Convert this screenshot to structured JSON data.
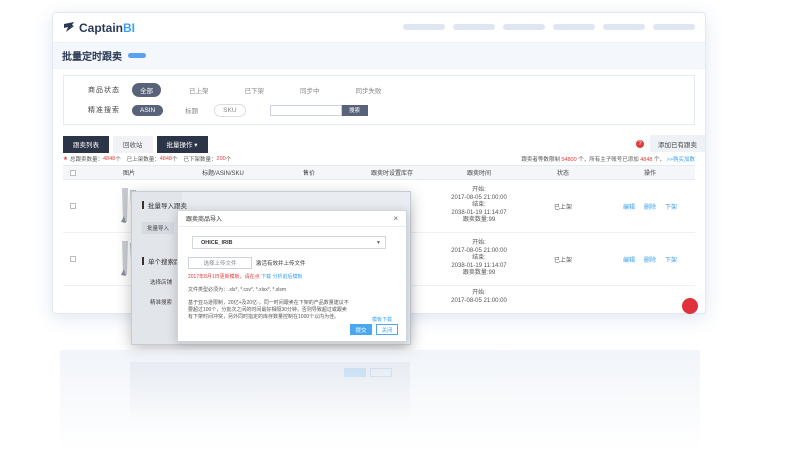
{
  "app": {
    "logo_text": "Captain",
    "logo_accent": "BI",
    "page_title": "批量定时跟卖"
  },
  "filters": {
    "status_label": "商品状态",
    "status_options": [
      "全部",
      "已上架",
      "已下架",
      "同步中",
      "同步失败"
    ],
    "search_label": "精准搜索",
    "search_options": [
      "ASIN",
      "标题",
      "SKU"
    ],
    "search_button": "搜索"
  },
  "toolbar": {
    "tab_follow": "跟卖列表",
    "tab_recycle": "回收站",
    "batch_button": "批量操作 ▾",
    "add_existing": "添加已有跟卖"
  },
  "stats": {
    "total_label": "总跟卖数量：",
    "total_value": "4848",
    "total_unit": "个",
    "on_label": "已上架数量：",
    "on_value": "4848",
    "on_unit": "个",
    "off_label": "已下架数量：",
    "off_value": "200",
    "off_unit": "个",
    "right_text_a": "跟卖者等数限制",
    "right_value_a": "54800",
    "right_text_b": "个，所有主子账号已添加",
    "right_value_b": "4848",
    "right_text_c": "个，",
    "right_link": ">>购买加数"
  },
  "table": {
    "headers": [
      "图片",
      "标题/ASIN/SKU",
      "售价",
      "跟卖时设置库存",
      "跟卖时间",
      "状态",
      "操作"
    ],
    "rows": [
      {
        "time_lines": [
          "开始:",
          "2017-08-05 21:00:00",
          "结束:",
          "2038-01-19 11:14:07",
          "跟卖数量:99"
        ],
        "status": "已上架",
        "ops": [
          "编辑",
          "删除",
          "下架"
        ]
      },
      {
        "time_lines": [
          "开始:",
          "2017-08-05 21:00:00",
          "结束:",
          "2038-01-19 11:14:07",
          "跟卖数量:99"
        ],
        "status": "已上架",
        "ops": [
          "编辑",
          "删除",
          "下架"
        ]
      },
      {
        "time_lines": [
          "开始:",
          "2017-08-05 21:00:00"
        ],
        "status": "",
        "ops": []
      }
    ]
  },
  "panel": {
    "section_batch": "批量导入跟卖",
    "side_button": "批量导入",
    "section_single": "单个搜索跟卖",
    "side_select": "选择店铺",
    "side_precise": "精准搜索"
  },
  "modal": {
    "title": "跟卖商品导入",
    "close": "×",
    "shop_value": "OHICE_IRIB",
    "upload_button": "选择上传文件",
    "upload_hint": "激活有效并上传文件",
    "template_note_red": "2017年8月1日更新模板，请在点",
    "template_note_link1": "下载",
    "template_note_link2": "分析前后模板",
    "file_types": "文件类型必须为：.xls*, *.csv*, *.xlsx*, *.xlsm",
    "desc_line1": "基于亚马逊限制，20亿+及20亿-，同一时间跟卖在下架的产品数量建议不",
    "desc_line2": "要超过100个，分批次之间的时间最好相隔30分钟，否则导致超过或跟卖",
    "desc_line3": "有下架时间冲突，另外同时指定的库存数量控制在1000个以内为佳。",
    "download_link": "模板下载",
    "submit": "提交",
    "cancel": "关闭"
  },
  "colors": {
    "accent": "#3aa0f0",
    "dark": "#2c3447",
    "red": "#e23b3b"
  }
}
